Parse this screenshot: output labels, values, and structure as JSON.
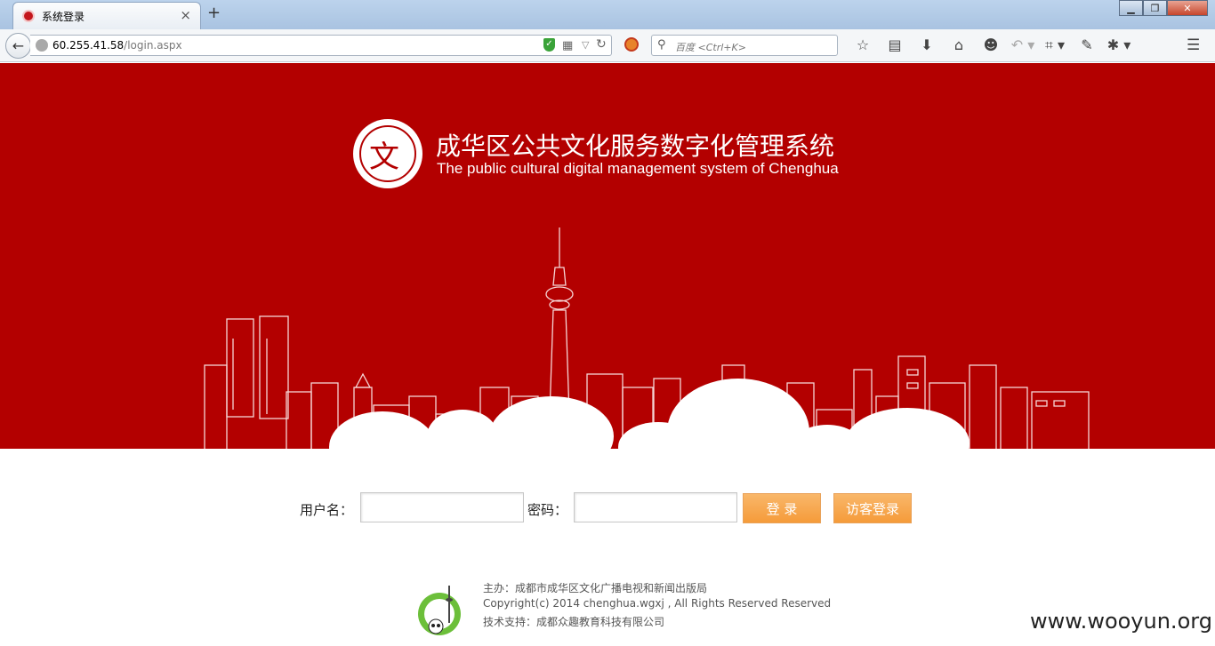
{
  "browser": {
    "tab_title": "系统登录",
    "tab_close": "×",
    "new_tab": "+",
    "url_host": "60.255.41.58",
    "url_path": "/login.aspx",
    "search_placeholder": "百度 <Ctrl+K>",
    "window_controls": {
      "minimize": "▁",
      "maximize": "❐",
      "close": "✕"
    }
  },
  "banner": {
    "title_cn": "成华区公共文化服务数字化管理系统",
    "title_en": "The public cultural digital management system of Chenghua",
    "logo_glyph": "文",
    "background_color": "#b30000"
  },
  "login": {
    "username_label": "用户名：",
    "username_value": "",
    "password_label": "密码：",
    "password_value": "",
    "login_button": "登 录",
    "guest_button": "访客登录",
    "button_color": "#f7a64f"
  },
  "footer": {
    "sponsor": "主办：成都市成华区文化广播电视和新闻出版局",
    "copyright": "Copyright(c) 2014 chenghua.wgxj , All Rights Reserved Reserved",
    "tech_support": "技术支持：成都众趣教育科技有限公司"
  },
  "watermark": "www.wooyun.org",
  "icons": [
    "back-icon",
    "globe-icon",
    "shield-icon",
    "qr-icon",
    "reload-icon",
    "block-icon",
    "search-icon",
    "star-icon",
    "reading-list-icon",
    "download-icon",
    "home-icon",
    "chat-icon",
    "undo-icon",
    "crop-icon",
    "comment-icon",
    "extension-icon",
    "menu-icon"
  ]
}
